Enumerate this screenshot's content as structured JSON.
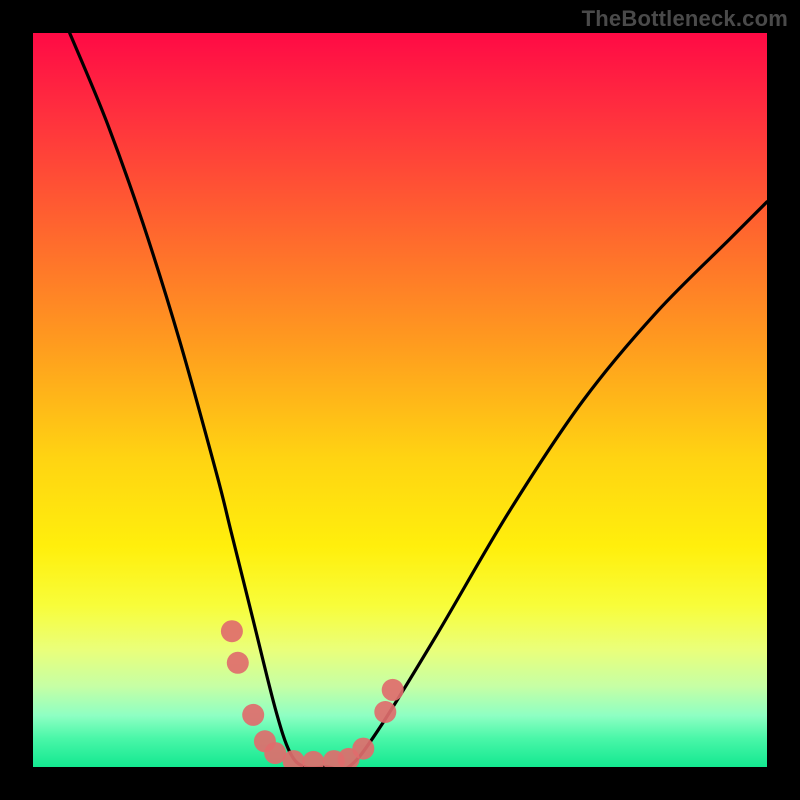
{
  "watermark": "TheBottleneck.com",
  "chart_data": {
    "type": "line",
    "title": "",
    "xlabel": "",
    "ylabel": "",
    "xlim": [
      0,
      100
    ],
    "ylim": [
      0,
      100
    ],
    "series": [
      {
        "name": "curve",
        "x": [
          5,
          10,
          15,
          20,
          25,
          27,
          30,
          33,
          35,
          37,
          40,
          43,
          47,
          55,
          65,
          75,
          85,
          95,
          100
        ],
        "y": [
          100,
          88,
          74,
          58,
          40,
          32,
          20,
          8,
          2,
          0,
          0,
          0,
          5,
          18,
          35,
          50,
          62,
          72,
          77
        ]
      }
    ],
    "markers": {
      "name": "salmon-dots",
      "points_xy": [
        [
          27.1,
          18.5
        ],
        [
          27.9,
          14.2
        ],
        [
          30.0,
          7.1
        ],
        [
          31.6,
          3.5
        ],
        [
          33.0,
          1.9
        ],
        [
          35.5,
          0.8
        ],
        [
          38.2,
          0.7
        ],
        [
          41.0,
          0.8
        ],
        [
          43.0,
          1.1
        ],
        [
          45.0,
          2.5
        ],
        [
          48.0,
          7.5
        ],
        [
          49.0,
          10.5
        ]
      ]
    },
    "gradient_stops": [
      {
        "pos": 0.0,
        "color": "#ff0a45"
      },
      {
        "pos": 0.28,
        "color": "#ff6a2d"
      },
      {
        "pos": 0.58,
        "color": "#ffd412"
      },
      {
        "pos": 0.84,
        "color": "#eaff7a"
      },
      {
        "pos": 1.0,
        "color": "#13e890"
      }
    ]
  }
}
